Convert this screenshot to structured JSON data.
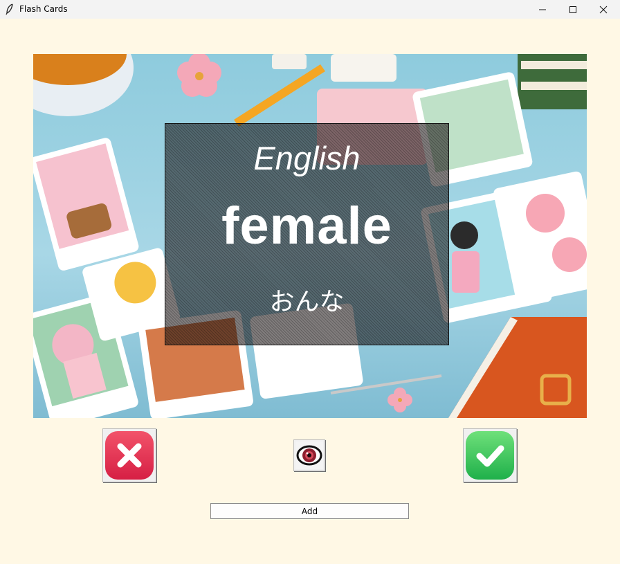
{
  "window": {
    "title": "Flash Cards",
    "icon": "feather-icon"
  },
  "card": {
    "language": "English",
    "word": "female",
    "reading": "おんな"
  },
  "buttons": {
    "wrong_icon": "x-mark-icon",
    "show_icon": "eye-icon",
    "right_icon": "checkmark-icon",
    "add_label": "Add"
  },
  "colors": {
    "background": "#fff8e5",
    "wrong": "#e23a56",
    "right": "#2fc25a"
  }
}
